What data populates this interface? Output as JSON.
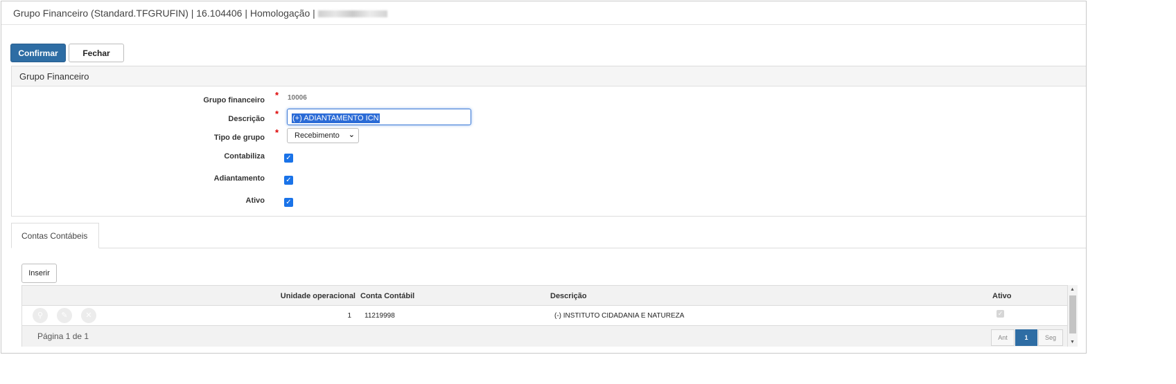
{
  "title": {
    "text": "Grupo Financeiro (Standard.TFGRUFIN) | 16.104406 | Homologação |"
  },
  "toolbar": {
    "confirm_label": "Confirmar",
    "close_label": "Fechar"
  },
  "panel": {
    "title": "Grupo Financeiro"
  },
  "form": {
    "grupo_label": "Grupo financeiro",
    "grupo_value": "10006",
    "descricao_label": "Descrição",
    "descricao_value": "(+) ADIANTAMENTO ICN",
    "tipo_label": "Tipo de grupo",
    "tipo_value": "Recebimento",
    "contabiliza_label": "Contabiliza",
    "contabiliza_checked": true,
    "adiantamento_label": "Adiantamento",
    "adiantamento_checked": true,
    "ativo_label": "Ativo",
    "ativo_checked": true,
    "required_mark": "*"
  },
  "tabs": [
    {
      "label": "Contas Contábeis",
      "active": true
    }
  ],
  "grid": {
    "insert_label": "Inserir",
    "columns": [
      "Unidade operacional",
      "Conta Contábil",
      "Descrição",
      "Ativo"
    ],
    "rows": [
      {
        "unidade": "1",
        "conta": "11219998",
        "descricao": "(-) INSTITUTO CIDADANIA E NATUREZA",
        "ativo": true
      }
    ],
    "row_actions": [
      "search-icon",
      "edit-icon",
      "remove-icon"
    ],
    "page_info": "Página 1 de 1",
    "pager": {
      "prev": "Ant",
      "current": "1",
      "next": "Seg"
    }
  },
  "colors": {
    "primary": "#2e6da4",
    "checkbox": "#1a73e8",
    "required": "#dd0000"
  }
}
